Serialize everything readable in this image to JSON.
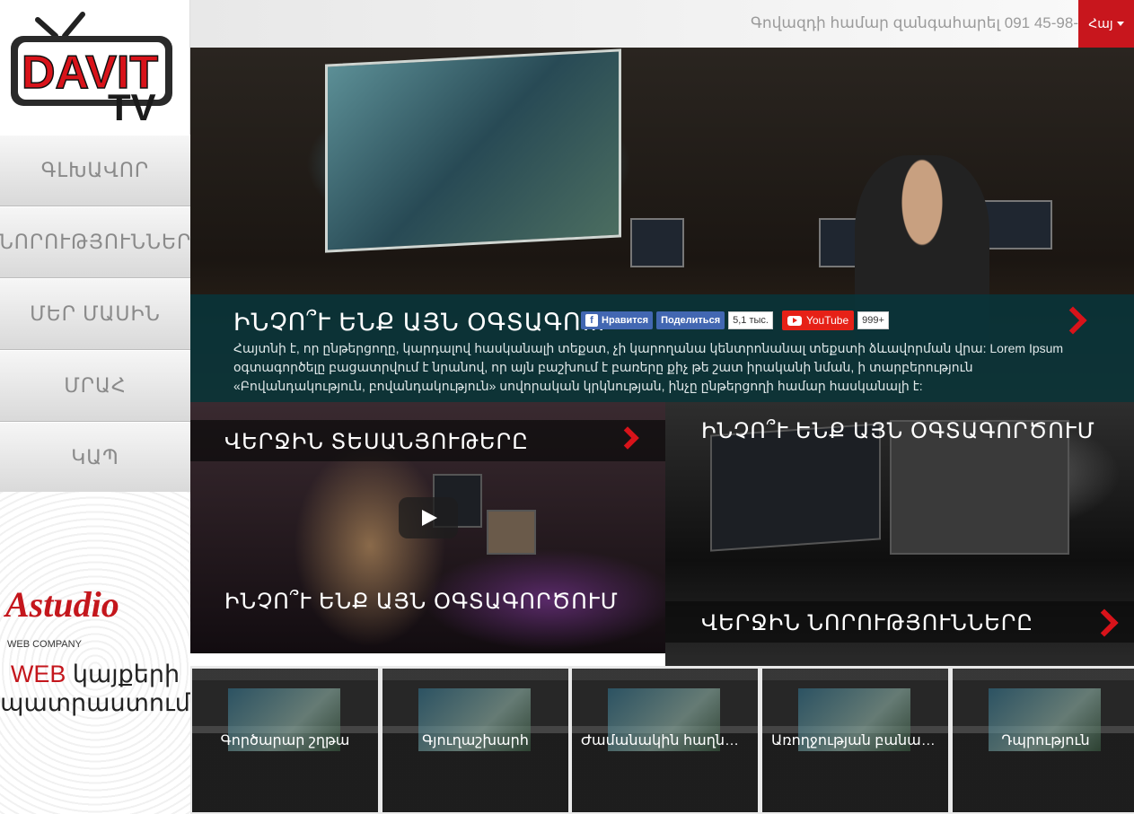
{
  "logo": {
    "line1": "DAVIT",
    "line2": "TV"
  },
  "nav": {
    "items": [
      {
        "label": "ԳԼԽԱՎՈՐ"
      },
      {
        "label": "ՆՈՐՈՒԹՅՈՒՆՆԵՐ"
      },
      {
        "label": "ՄԵՐ ՄԱՍԻՆ"
      },
      {
        "label": "ՄՐԱՀ"
      },
      {
        "label": "ԿԱՊ"
      }
    ]
  },
  "ad": {
    "brand": "Astudio",
    "brand_sub": "WEB COMPANY",
    "tag_red": "WEB",
    "tag_rest": " կայքերի",
    "tag_line2": "պատրաստում"
  },
  "topbar": {
    "phone": "Գովազդի համար զանգահարել 091 45-98-",
    "lang": "Հայ"
  },
  "hero": {
    "title": "ԻՆՉՈ՞Ւ ԵՆՔ ԱՅՆ ՕԳՏԱԳՈ…",
    "text": "Հայտնի է, որ ընթերցողը, կարդալով հասկանալի տեքստ, չի կարողանա կենտրոնանալ տեքստի ձևավորման վրա: Lorem Ipsum օգտագործելը բացատրվում է նրանով, որ այն բաշխում է բառերը քիչ թե շատ իրականի նման, ի տարբերություն «Բովանդակություն, բովանդակություն» սովորական կրկնության, ինչը ընթերցողի համար հասկանալի է:",
    "social": {
      "like_label": "Нравится",
      "share_label": "Поделиться",
      "fb_count": "5,1 тыс.",
      "yt_label": "YouTube",
      "yt_count": "999+"
    }
  },
  "tiles": {
    "left_top_title": "ՎԵՐՋԻՆ ՏԵՍԱՆՅՈՒԹԵՐԸ",
    "left_bottom_title": "ԻՆՉՈ՞Ւ ԵՆՔ ԱՅՆ ՕԳՏԱԳՈՐԾՈՒՄ",
    "right_top_title": "ԻՆՉՈ՞Ւ ԵՆՔ ԱՅՆ ՕԳՏԱԳՈՐԾՈՒՄ",
    "right_bottom_title": "ՎԵՐՋԻՆ ՆՈՐՈՒԹՅՈՒՆՆԵՐԸ"
  },
  "categories": [
    {
      "label": "Գործարար շղթա"
    },
    {
      "label": "Գյուղաշխարհ"
    },
    {
      "label": "Ժամանակին հաղնթ…"
    },
    {
      "label": "Առողջության բանաձև"
    },
    {
      "label": "Դպրություն"
    }
  ],
  "colors": {
    "accent": "#c8161d",
    "overlay": "#08343a"
  }
}
